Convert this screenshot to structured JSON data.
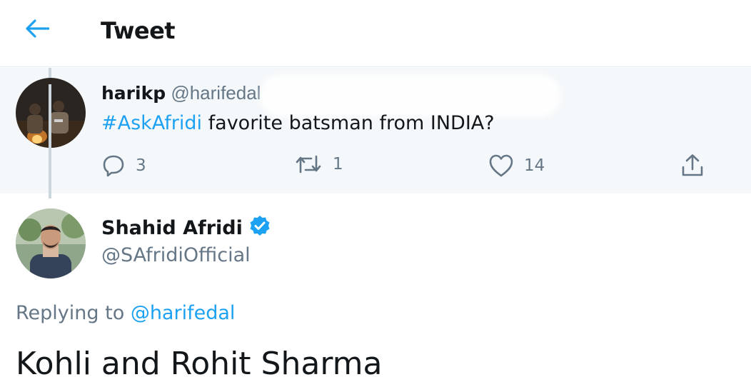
{
  "header": {
    "title": "Tweet",
    "back_icon": "arrow-left-icon",
    "accent": "#1da1f2"
  },
  "parent_tweet": {
    "display_name": "harikp",
    "handle": "@harifedal",
    "hashtag": "#AskAfridi",
    "text": " favorite batsman from INDIA?",
    "replies": "3",
    "retweets": "1",
    "likes": "14"
  },
  "main_tweet": {
    "display_name": "Shahid Afridi",
    "verified_icon": "verified-badge-icon",
    "handle": "@SAfridiOfficial",
    "replying_prefix": "Replying to ",
    "replying_to": "@harifedal",
    "text": "Kohli and Rohit Sharma"
  },
  "colors": {
    "link": "#1da1f2",
    "muted": "#657786",
    "parent_bg": "#f5f8fa",
    "thread_line": "#ccd6dd"
  }
}
